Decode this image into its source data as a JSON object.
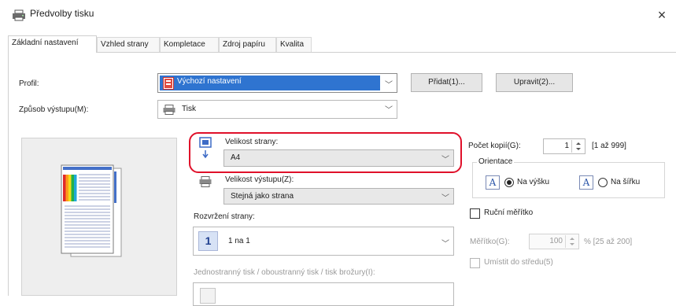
{
  "window": {
    "title": "Předvolby tisku",
    "close_glyph": "×"
  },
  "tabs": [
    {
      "label": "Základní nastavení",
      "active": true
    },
    {
      "label": "Vzhled strany"
    },
    {
      "label": "Kompletace"
    },
    {
      "label": "Zdroj papíru"
    },
    {
      "label": "Kvalita"
    }
  ],
  "profile": {
    "label": "Profil:",
    "value": "Výchozí nastavení",
    "add_button": "Přidat(1)...",
    "edit_button": "Upravit(2)..."
  },
  "output": {
    "label": "Způsob výstupu(M):",
    "value": "Tisk"
  },
  "page_size": {
    "label": "Velikost strany:",
    "value": "A4"
  },
  "output_size": {
    "label": "Velikost výstupu(Z):",
    "value": "Stejná jako strana"
  },
  "layout": {
    "label": "Rozvržení strany:",
    "value": "1 na 1",
    "icon_number": "1"
  },
  "duplex": {
    "label": "Jednostranný tisk / oboustranný tisk / tisk brožury(I):"
  },
  "copies": {
    "label": "Počet kopií(G):",
    "value": "1",
    "range": "[1 až 999]"
  },
  "orientation": {
    "label": "Orientace",
    "portrait_label": "Na výšku",
    "landscape_label": "Na šířku",
    "icon_letter": "A",
    "selected": "portrait"
  },
  "manual_scale": {
    "label": "Ruční měřítko",
    "scale_label": "Měřítko(G):",
    "scale_value": "100",
    "scale_range": "% [25 až 200]",
    "center_label": "Umístit do středu(5)"
  },
  "colors": {
    "highlight": "#e0102a",
    "accent": "#2b55a8"
  }
}
